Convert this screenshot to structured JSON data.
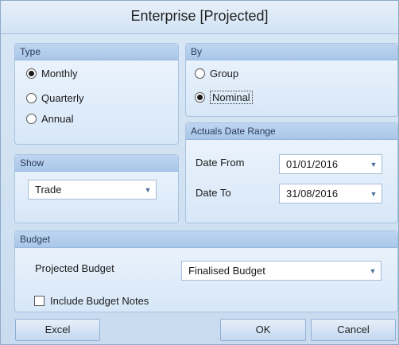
{
  "window": {
    "title": "Enterprise [Projected]"
  },
  "type_group": {
    "header": "Type",
    "options": [
      {
        "label": "Monthly",
        "checked": true
      },
      {
        "label": "Quarterly",
        "checked": false
      },
      {
        "label": "Annual",
        "checked": false
      }
    ]
  },
  "by_group": {
    "header": "By",
    "options": [
      {
        "label": "Group",
        "checked": false
      },
      {
        "label": "Nominal",
        "checked": true
      }
    ]
  },
  "show_group": {
    "header": "Show",
    "combo_value": "Trade"
  },
  "date_group": {
    "header": "Actuals Date Range",
    "from_label": "Date From",
    "from_value": "01/01/2016",
    "to_label": "Date To",
    "to_value": "31/08/2016"
  },
  "budget_group": {
    "header": "Budget",
    "projected_label": "Projected Budget",
    "projected_value": "Finalised Budget",
    "notes_label": "Include Budget Notes",
    "notes_checked": false
  },
  "buttons": {
    "excel": "Excel",
    "ok": "OK",
    "cancel": "Cancel"
  },
  "icons": {
    "dropdown": "chevron-down-icon"
  }
}
